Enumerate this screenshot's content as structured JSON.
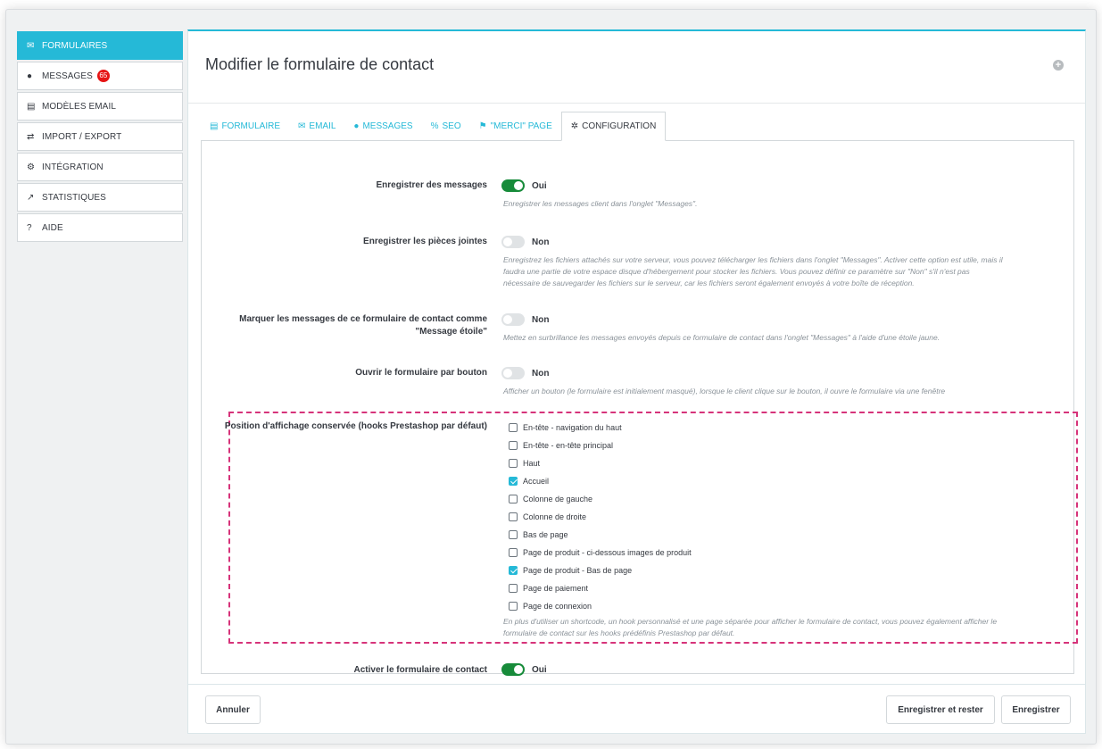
{
  "sidebar": {
    "items": [
      {
        "label": "FORMULAIRES",
        "icon": "envelope-icon",
        "glyph": "✉"
      },
      {
        "label": "MESSAGES",
        "icon": "comments-icon",
        "glyph": "●",
        "badge": "65"
      },
      {
        "label": "MODÈLES EMAIL",
        "icon": "file-icon",
        "glyph": "▤"
      },
      {
        "label": "IMPORT / EXPORT",
        "icon": "exchange-icon",
        "glyph": "⇄"
      },
      {
        "label": "INTÉGRATION",
        "icon": "cogs-icon",
        "glyph": "⚙"
      },
      {
        "label": "STATISTIQUES",
        "icon": "line-chart-icon",
        "glyph": "↗"
      },
      {
        "label": "AIDE",
        "icon": "question-circle-icon",
        "glyph": "?"
      }
    ]
  },
  "header": {
    "title": "Modifier le formulaire de contact"
  },
  "tabs": [
    {
      "label": "FORMULAIRE",
      "icon": "list-icon",
      "glyph": "▤"
    },
    {
      "label": "EMAIL",
      "icon": "envelope-icon",
      "glyph": "✉"
    },
    {
      "label": "MESSAGES",
      "icon": "comments-icon",
      "glyph": "●"
    },
    {
      "label": "SEO",
      "icon": "percent-icon",
      "glyph": "%"
    },
    {
      "label": "\"MERCI\" PAGE",
      "icon": "flag-icon",
      "glyph": "⚑"
    },
    {
      "label": "CONFIGURATION",
      "icon": "cog-icon",
      "glyph": "✲"
    }
  ],
  "form": {
    "save_messages": {
      "label": "Enregistrer des messages",
      "state": "Oui",
      "help": "Enregistrer les messages client dans l'onglet \"Messages\"."
    },
    "save_attachments": {
      "label": "Enregistrer les pièces jointes",
      "state": "Non",
      "help_lines": [
        "Enregistrez les fichiers attachés sur votre serveur, vous pouvez télécharger les fichiers dans l'onglet \"Messages\". Activer cette option est utile, mais il",
        "faudra une partie de votre espace disque d'hébergement pour stocker les fichiers. Vous pouvez définir ce paramètre sur \"Non\" s'il n'est pas",
        "nécessaire de sauvegarder les fichiers sur le serveur, car les fichiers seront également envoyés à votre boîte de réception."
      ]
    },
    "star_messages": {
      "label_lines": [
        "Marquer les messages de ce formulaire de contact comme",
        "\"Message étoile\""
      ],
      "state": "Non",
      "help": "Mettez en surbrillance les messages envoyés depuis ce formulaire de contact dans l'onglet \"Messages\" à l'aide d'une étoile jaune."
    },
    "open_by_button": {
      "label": "Ouvrir le formulaire par bouton",
      "state": "Non",
      "help": "Afficher un bouton (le formulaire est initialement masqué), lorsque le client clique sur le bouton, il ouvre le formulaire via une fenêtre"
    },
    "positions": {
      "label": "Position d'affichage conservée (hooks Prestashop par défaut)",
      "options": [
        {
          "label": "En-tête - navigation du haut",
          "checked": false
        },
        {
          "label": "En-tête - en-tête principal",
          "checked": false
        },
        {
          "label": "Haut",
          "checked": false
        },
        {
          "label": "Accueil",
          "checked": true
        },
        {
          "label": "Colonne de gauche",
          "checked": false
        },
        {
          "label": "Colonne de droite",
          "checked": false
        },
        {
          "label": "Bas de page",
          "checked": false
        },
        {
          "label": "Page de produit - ci-dessous images de produit",
          "checked": false
        },
        {
          "label": "Page de produit - Bas de page",
          "checked": true
        },
        {
          "label": "Page de paiement",
          "checked": false
        },
        {
          "label": "Page de connexion",
          "checked": false
        }
      ],
      "help_lines": [
        "En plus d'utiliser un shortcode, un hook personnalisé et une page séparée pour afficher le formulaire de contact, vous pouvez également afficher le",
        "formulaire de contact sur les hooks prédéfinis Prestashop par défaut."
      ]
    },
    "enable_form": {
      "label": "Activer le formulaire de contact",
      "state": "Oui"
    }
  },
  "footer": {
    "cancel_label": "Annuler",
    "save_stay_label": "Enregistrer et rester",
    "save_label": "Enregistrer"
  },
  "colors": {
    "accent": "#25b9d7",
    "switch_on": "#178b3a",
    "highlight": "#d6337a",
    "badge": "#e61414"
  }
}
